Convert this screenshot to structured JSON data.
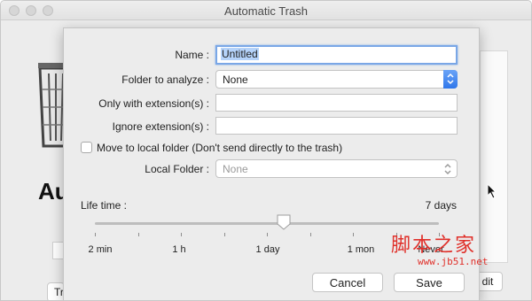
{
  "window": {
    "title": "Automatic Trash"
  },
  "background": {
    "heading": "Au",
    "button_left": "Tr",
    "button_right": "dit"
  },
  "dialog": {
    "name_label": "Name :",
    "name_value": "Untitled",
    "folder_label": "Folder to analyze :",
    "folder_value": "None",
    "only_ext_label": "Only with extension(s) :",
    "only_ext_value": "",
    "ignore_ext_label": "Ignore extension(s) :",
    "ignore_ext_value": "",
    "move_local_label": "Move to local folder (Don't send directly to the trash)",
    "move_local_checked": false,
    "local_folder_label": "Local Folder :",
    "local_folder_value": "None",
    "lifetime_label": "Life time :",
    "lifetime_value": "7 days",
    "slider": {
      "ticks": [
        "2 min",
        "1 h",
        "1 day",
        "1 mon",
        "Never"
      ],
      "position_fraction": 0.55
    },
    "cancel_label": "Cancel",
    "save_label": "Save"
  },
  "watermark": {
    "text": "脚本之家",
    "url": "www.jb51.net"
  },
  "colors": {
    "accent": "#3b82f6",
    "focus_ring": "#7aa7e6",
    "selection": "#b5d3fa",
    "watermark": "#e0302a"
  }
}
